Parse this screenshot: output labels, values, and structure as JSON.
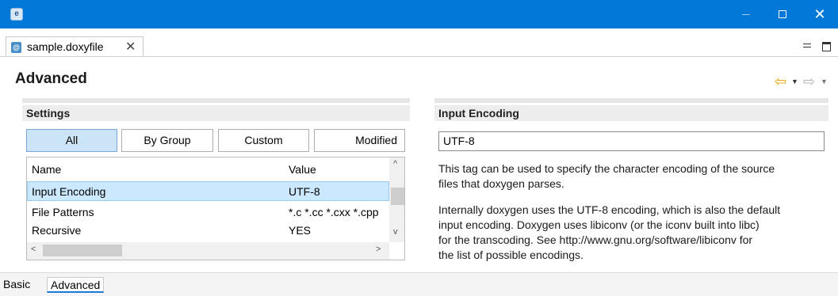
{
  "window": {
    "app_icon_text": "e",
    "minimize_glyph": "—",
    "close_glyph": "✕"
  },
  "editor_tab": {
    "icon_text": "@",
    "label": "sample.doxyfile",
    "close_glyph": "✕"
  },
  "page": {
    "title": "Advanced",
    "nav": {
      "back_glyph": "⇦",
      "dropdown_glyph": "▼",
      "forward_glyph": "⇨"
    }
  },
  "settings": {
    "header": "Settings",
    "filters": [
      "All",
      "By Group",
      "Custom",
      "Modified"
    ],
    "active_filter": "All",
    "columns": [
      "Name",
      "Value"
    ],
    "rows": [
      {
        "name": "Input Encoding",
        "value": "UTF-8",
        "selected": true
      },
      {
        "name": "File Patterns",
        "value": "*.c *.cc *.cxx *.cpp",
        "selected": false
      },
      {
        "name": "Recursive",
        "value": "YES",
        "selected": false
      }
    ],
    "scroll": {
      "up": "^",
      "down": "v",
      "left": "<",
      "right": ">"
    }
  },
  "detail": {
    "header": "Input Encoding",
    "value": "UTF-8",
    "paragraph1": [
      "This tag can be used to specify the character encoding of the source",
      "files that doxygen parses."
    ],
    "paragraph2": [
      "Internally doxygen uses the UTF-8 encoding, which is also the default",
      "input encoding. Doxygen uses libiconv (or the iconv built into libc)",
      "for the transcoding. See http://www.gnu.org/software/libiconv for",
      "the list of possible encodings."
    ]
  },
  "bottom_tabs": [
    "Basic",
    "Advanced"
  ],
  "active_bottom_tab": "Advanced",
  "colors": {
    "titlebar": "#0078d7",
    "selection": "#cce8ff",
    "active_button": "#cce4f7",
    "nav_back": "#e6a800"
  }
}
